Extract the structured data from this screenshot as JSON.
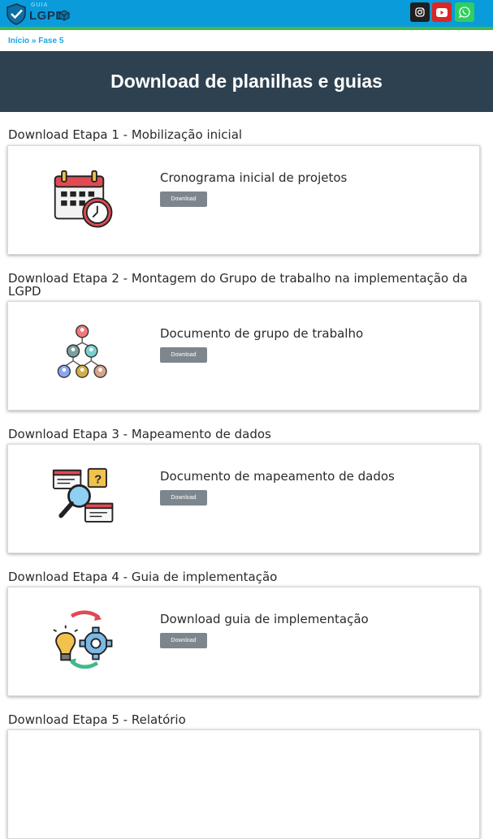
{
  "brand": {
    "name_top": "GUIA",
    "name_main": "LGPD"
  },
  "social": [
    {
      "name": "instagram-icon"
    },
    {
      "name": "youtube-icon"
    },
    {
      "name": "whatsapp-icon"
    }
  ],
  "breadcrumb": {
    "home": "Início",
    "separator": " » ",
    "current": "Fase 5"
  },
  "hero": {
    "title": "Download de planilhas e guias"
  },
  "sections": [
    {
      "title": "Download Etapa 1 - Mobilização inicial",
      "card_title": "Cronograma inicial de projetos",
      "button": "Download",
      "icon": "calendar-clock-icon"
    },
    {
      "title": "Download Etapa 2 - Montagem do Grupo de trabalho na implementação da LGPD",
      "card_title": "Documento de grupo de trabalho",
      "button": "Download",
      "icon": "team-hierarchy-icon"
    },
    {
      "title": "Download Etapa 3 - Mapeamento de dados",
      "card_title": "Documento de mapeamento de dados",
      "button": "Download",
      "icon": "data-search-icon"
    },
    {
      "title": "Download Etapa 4 - Guia de implementação",
      "card_title": "Download guia de implementação",
      "button": "Download",
      "icon": "idea-gear-icon"
    },
    {
      "title": "Download Etapa 5 - Relatório"
    }
  ]
}
